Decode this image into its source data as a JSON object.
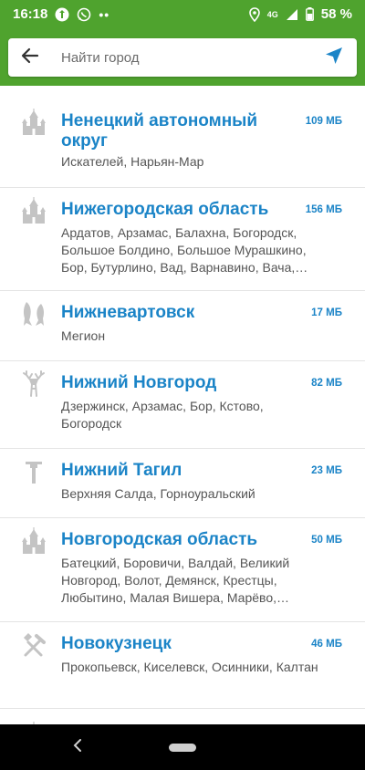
{
  "status_bar": {
    "time": "16:18",
    "dots": "••",
    "network_top": "4G",
    "battery": "58 %"
  },
  "search": {
    "placeholder": "Найти город",
    "back_icon": "arrow-left-icon",
    "locate_icon": "navigation-arrow-icon"
  },
  "items": [
    {
      "title": "Ненецкий автономный округ",
      "size": "109 МБ",
      "subtitle": "Искателей, Нарьян-Мар",
      "icon": "kremlin-icon"
    },
    {
      "title": "Нижегородская область",
      "size": "156 МБ",
      "subtitle": "Ардатов, Арзамас, Балахна, Богородск, Большое Болдино, Большое Мурашкино, Бор, Бутурлино, Вад, Варнавино, Вача, Воскресенское",
      "icon": "kremlin-icon"
    },
    {
      "title": "Нижневартовск",
      "size": "17 МБ",
      "subtitle": "Мегион",
      "icon": "fish-icon"
    },
    {
      "title": "Нижний Новгород",
      "size": "82 МБ",
      "subtitle": "Дзержинск, Арзамас, Бор, Кстово, Богородск",
      "icon": "deer-icon"
    },
    {
      "title": "Нижний Тагил",
      "size": "23 МБ",
      "subtitle": "Верхняя Салда, Горноуральский",
      "icon": "hammer-icon"
    },
    {
      "title": "Новгородская область",
      "size": "50 МБ",
      "subtitle": "Батецкий, Боровичи, Валдай, Великий Новгород, Волот, Демянск, Крестцы, Любытино, Малая Вишера, Марёво, Мошенское",
      "icon": "kremlin-icon"
    },
    {
      "title": "Новокузнецк",
      "size": "46 МБ",
      "subtitle": "Прокопьевск, Киселевск, Осинники, Калтан",
      "icon": "tools-icon"
    }
  ],
  "colors": {
    "brand_green": "#4fa32e",
    "link_blue": "#1b84c7"
  }
}
